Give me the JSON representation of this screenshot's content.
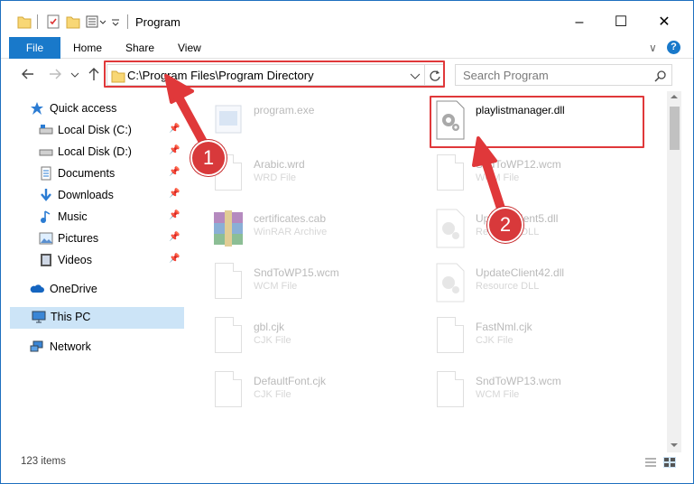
{
  "window": {
    "title": "Program",
    "minimize_glyph": "–",
    "maximize_glyph": "☐",
    "close_glyph": "✕"
  },
  "ribbon": {
    "tabs": [
      "File",
      "Home",
      "Share",
      "View"
    ],
    "expand_glyph": "∨",
    "help_glyph": "?"
  },
  "address": {
    "path": "C:\\Program Files\\Program Directory",
    "search_placeholder": "Search Program"
  },
  "sidebar": {
    "items": [
      {
        "label": "Quick access",
        "icon": "star-icon"
      },
      {
        "label": "Local Disk (C:)",
        "icon": "drive-icon",
        "pinned": true
      },
      {
        "label": "Local Disk (D:)",
        "icon": "drive-icon",
        "pinned": true
      },
      {
        "label": "Documents",
        "icon": "documents-icon",
        "pinned": true
      },
      {
        "label": "Downloads",
        "icon": "downloads-icon",
        "pinned": true
      },
      {
        "label": "Music",
        "icon": "music-icon",
        "pinned": true
      },
      {
        "label": "Pictures",
        "icon": "pictures-icon",
        "pinned": true
      },
      {
        "label": "Videos",
        "icon": "videos-icon",
        "pinned": true
      },
      {
        "label": "OneDrive",
        "icon": "cloud-icon"
      },
      {
        "label": "This PC",
        "icon": "computer-icon",
        "selected": true
      },
      {
        "label": "Network",
        "icon": "network-icon"
      }
    ]
  },
  "files": [
    {
      "name": "program.exe",
      "type": "",
      "icon": "exe-icon"
    },
    {
      "name": "playlistmanager.dll",
      "type": "",
      "icon": "dll-gear-icon",
      "highlighted": true
    },
    {
      "name": "Arabic.wrd",
      "type": "WRD File",
      "icon": "document-icon"
    },
    {
      "name": "SndToWP12.wcm",
      "type": "WCM File",
      "icon": "document-icon"
    },
    {
      "name": "certificates.cab",
      "type": "WinRAR Archive",
      "icon": "archive-icon"
    },
    {
      "name": "UpdateClient5.dll",
      "type": "Resource DLL",
      "icon": "dll-gear-icon"
    },
    {
      "name": "SndToWP15.wcm",
      "type": "WCM File",
      "icon": "document-icon"
    },
    {
      "name": "UpdateClient42.dll",
      "type": "Resource DLL",
      "icon": "dll-gear-icon"
    },
    {
      "name": "gbl.cjk",
      "type": "CJK File",
      "icon": "document-icon"
    },
    {
      "name": "FastNml.cjk",
      "type": "CJK File",
      "icon": "document-icon"
    },
    {
      "name": "DefaultFont.cjk",
      "type": "CJK File",
      "icon": "document-icon"
    },
    {
      "name": "SndToWP13.wcm",
      "type": "WCM File",
      "icon": "document-icon"
    }
  ],
  "status": {
    "item_count": "123 items"
  },
  "annotations": {
    "step1": "1",
    "step2": "2",
    "color": "#e0383a"
  }
}
